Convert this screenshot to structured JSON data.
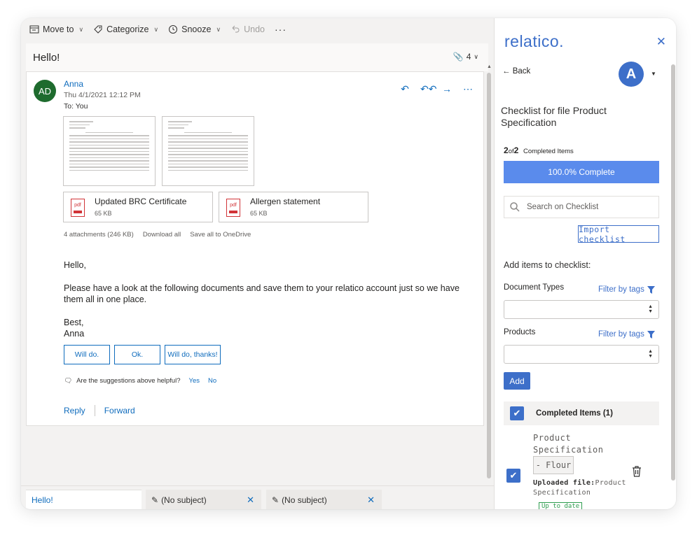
{
  "toolbar": {
    "move_to": "Move to",
    "categorize": "Categorize",
    "snooze": "Snooze",
    "undo": "Undo",
    "more": "···"
  },
  "email": {
    "subject": "Hello!",
    "attachment_count": "4",
    "avatar_initials": "AD",
    "sender": "Anna",
    "date": "Thu 4/1/2021 12:12 PM",
    "to_label": "To:",
    "to_value": "You",
    "attachments": [
      {
        "name": "Updated BRC Certificate",
        "size": "65 KB",
        "icon": "pdf"
      },
      {
        "name": "Allergen statement",
        "size": "65 KB",
        "icon": "pdf"
      }
    ],
    "attachments_summary": "4 attachments (246 KB)",
    "download_all": "Download all",
    "save_onedrive": "Save all to OneDrive",
    "greeting": "Hello,",
    "body_line1": "Please have a look at the following documents and save them to your relatico account just so we have",
    "body_line2": "them all in one place.",
    "closing": "Best,",
    "signature": "Anna",
    "suggestions": [
      "Will do.",
      "Ok.",
      "Will do, thanks!"
    ],
    "helpful_question": "Are the suggestions above helpful?",
    "helpful_yes": "Yes",
    "helpful_no": "No",
    "reply": "Reply",
    "forward": "Forward"
  },
  "bottom_tabs": [
    {
      "label": "Hello!"
    },
    {
      "label": "(No subject)"
    },
    {
      "label": "(No subject)"
    }
  ],
  "panel": {
    "logo": "relatico.",
    "back": "Back",
    "user_initial": "A",
    "title": "Checklist for file Product Specification",
    "count_done": "2",
    "count_of": "of",
    "count_total": "2",
    "count_label": "Completed Items",
    "progress_percent": 100,
    "progress_label": "100.0% Complete",
    "search_placeholder": "Search on Checklist",
    "import_button": "Import checklist",
    "add_heading": "Add items to checklist:",
    "document_types_label": "Document Types",
    "products_label": "Products",
    "filter_by_tags": "Filter by tags",
    "add_button": "Add",
    "completed_header": "Completed Items (1)",
    "item": {
      "name": "Product Specification",
      "tag": "- Flour",
      "uploaded_label": "Uploaded file:",
      "uploaded_value": "Product Specification",
      "status": "Up to date"
    }
  },
  "colors": {
    "outlook_blue": "#0f6cbd",
    "relatico_blue": "#3d6fc9",
    "progress_fill": "#5a8bec",
    "avatar_green": "#1e6b2e",
    "status_green": "#2e9d4f"
  }
}
